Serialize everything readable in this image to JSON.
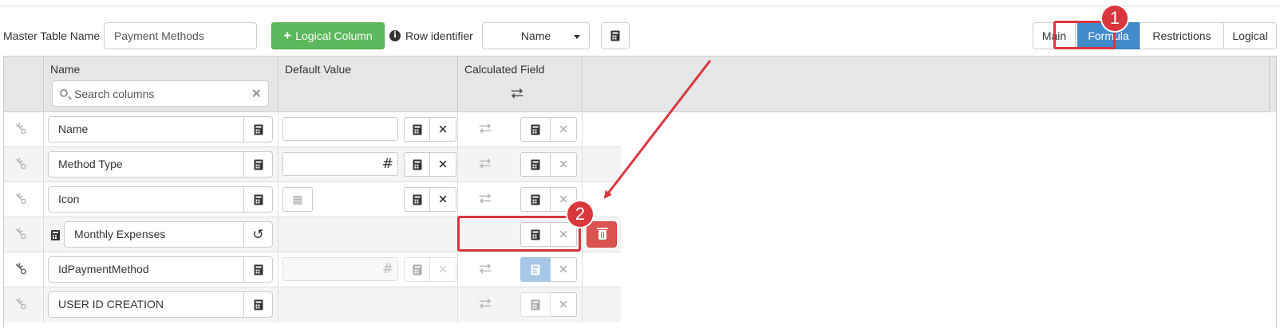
{
  "toolbar": {
    "master_table_label": "Master Table Name",
    "master_table_value": "Payment Methods",
    "logical_column_button": "Logical Column",
    "info_icon": "info-circle-icon",
    "row_identifier_label": "Row identifier",
    "row_identifier_value": "Name",
    "calculator_icon": "calculator-icon"
  },
  "tabs": [
    {
      "label": "Main",
      "active": false
    },
    {
      "label": "Formula",
      "active": true
    },
    {
      "label": "Restrictions",
      "active": false
    },
    {
      "label": "Logical",
      "active": false
    }
  ],
  "grid": {
    "headers": {
      "name": "Name",
      "default_value": "Default Value",
      "calculated_field": "Calculated Field"
    },
    "search_placeholder": "Search columns",
    "rows": [
      {
        "name": "Name"
      },
      {
        "name": "Method Type"
      },
      {
        "name": "Icon"
      },
      {
        "name": "Monthly Expenses"
      },
      {
        "name": "IdPaymentMethod"
      },
      {
        "name": "USER ID CREATION"
      }
    ]
  },
  "annotations": {
    "badge_1": "1",
    "badge_2": "2",
    "color": "#d9363e"
  }
}
